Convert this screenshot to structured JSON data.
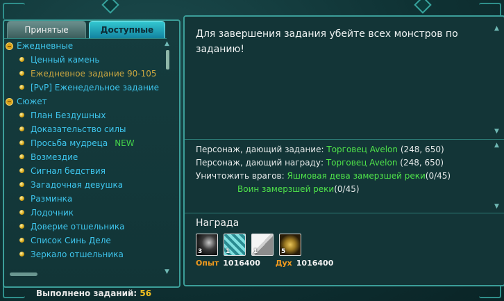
{
  "tabs": {
    "accepted": "Принятые",
    "available": "Доступные"
  },
  "quest_list": {
    "categories": [
      {
        "label": "Ежедневные",
        "items": [
          {
            "label": "Ценный камень"
          },
          {
            "label": "Ежедневное задание 90-105",
            "selected": true
          },
          {
            "label": "[PvP] Еженедельное задание"
          }
        ]
      },
      {
        "label": "Сюжет",
        "items": [
          {
            "label": "План Бездушных"
          },
          {
            "label": "Доказательство силы"
          },
          {
            "label": "Просьба мудреца",
            "badge": "NEW"
          },
          {
            "label": "Возмездие"
          },
          {
            "label": "Сигнал бедствия"
          },
          {
            "label": "Загадочная девушка"
          },
          {
            "label": "Разминка"
          },
          {
            "label": "Лодочник"
          },
          {
            "label": "Доверие отшельника"
          },
          {
            "label": "Список Синь Деле"
          },
          {
            "label": "Зеркало отшельника"
          }
        ]
      }
    ]
  },
  "footer": {
    "completed_label": "Выполнено заданий:",
    "completed_count": "56"
  },
  "quest_detail": {
    "description": "Для завершения задания убейте всех монстров по заданию!",
    "giver_label": "Персонаж, дающий задание:",
    "giver_name": "Торговец Avelon",
    "giver_coords": "(248, 650)",
    "reward_npc_label": "Персонаж, дающий награду:",
    "reward_npc_name": "Торговец Avelon",
    "reward_npc_coords": "(248, 650)",
    "kill_label": "Уничтожить врагов:",
    "targets": [
      {
        "name": "Яшмовая дева замерзшей реки",
        "count": "(0/45)"
      },
      {
        "name": "Воин замерзшей реки",
        "count": "(0/45)"
      }
    ]
  },
  "reward": {
    "title": "Награда",
    "items": [
      {
        "icon": "orb-item-icon",
        "count": "3"
      },
      {
        "icon": "crystal-item-icon",
        "count": "1"
      },
      {
        "icon": "scroll-item-icon",
        "count": "1"
      },
      {
        "icon": "gold-ore-item-icon",
        "count": "5"
      }
    ],
    "exp_label": "Опыт",
    "exp_value": "1016400",
    "spirit_label": "Дух",
    "spirit_value": "1016400"
  },
  "colors": {
    "accent_cyan": "#3ec6ee",
    "highlight_green": "#4fe34a",
    "gold": "#f2c020",
    "selected_item": "#c9a640"
  }
}
